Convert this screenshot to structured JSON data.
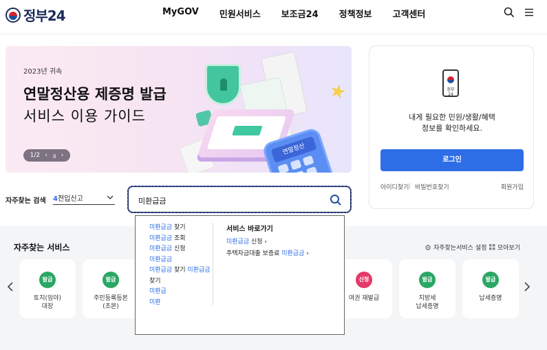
{
  "header": {
    "logo_text": "정부24",
    "nav": [
      "MyGOV",
      "민원서비스",
      "보조금24",
      "정책정보",
      "고객센터"
    ]
  },
  "banner": {
    "subtitle": "2023년 귀속",
    "title_line1": "연말정산용 제증명 발급",
    "title_line2": "서비스 이용 가이드",
    "pager": "1/2",
    "calc_label": "연말정산"
  },
  "login_card": {
    "phone_label": "정부24",
    "message_line1": "내게 필요한 민원/생활/혜택",
    "message_line2": "정보를 확인하세요.",
    "login_button": "로그인",
    "find_id": "아이디찾기",
    "find_pw": "비밀번호찾기",
    "signup": "회원가입"
  },
  "search": {
    "fav_label": "자주찾는 검색",
    "select_num": "4",
    "select_value": "전입신고",
    "input_value": "미환급금"
  },
  "favorites": {
    "title": "자주찾는 서비스",
    "setting": "자주찾는서비스 설정",
    "more": "모아보기",
    "items": [
      {
        "badge": "발급",
        "label1": "토지(임야)",
        "label2": "대장"
      },
      {
        "badge": "발급",
        "label1": "주민등록등본",
        "label2": "(초본)"
      },
      {
        "badge": "신청",
        "label1": "여권 재발급",
        "label2": ""
      },
      {
        "badge": "발급",
        "label1": "지방세",
        "label2": "납세증명"
      },
      {
        "badge": "발급",
        "label1": "납세증명",
        "label2": ""
      }
    ]
  },
  "dropdown": {
    "suggestions": [
      {
        "hl": "미환급금",
        "rest": " 찾기"
      },
      {
        "hl": "미환급금",
        "rest": " 조회"
      },
      {
        "hl": "미환급금",
        "rest": " 신청"
      },
      {
        "hl": "미환급금",
        "rest": ""
      },
      {
        "hl": "미환급금",
        "rest": " 찾기 ",
        "hl2": "미환급금",
        "rest2": " 찾기"
      },
      {
        "hl": "미환급",
        "rest": ""
      },
      {
        "hl": "미환",
        "rest": ""
      }
    ],
    "service_head": "서비스 바로가기",
    "service_links": [
      {
        "pre": "",
        "hl": "미환급금",
        "post": " 신청  ›"
      },
      {
        "pre": "주택자금대출 보증료 ",
        "hl": "미환급금",
        "post": "  ›"
      }
    ]
  },
  "colors": {
    "brand_navy": "#1c2b5a",
    "accent_blue": "#2d6ee6",
    "badge_green": "#2aa764",
    "badge_red": "#e5396a"
  }
}
